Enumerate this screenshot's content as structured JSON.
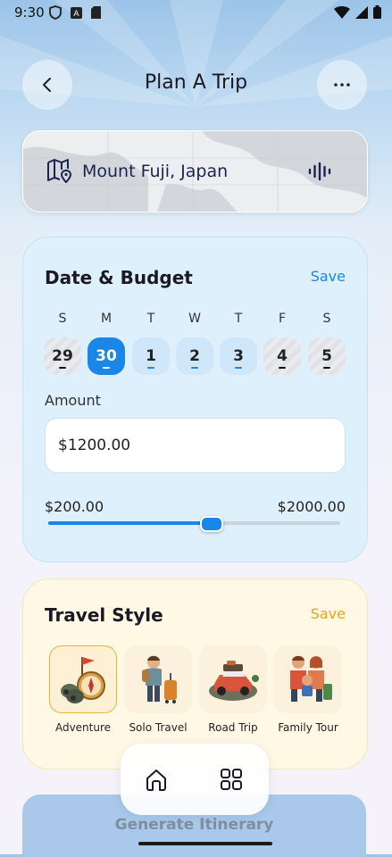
{
  "status_bar": {
    "time": "9:30"
  },
  "header": {
    "title": "Plan A Trip"
  },
  "destination": {
    "location": "Mount Fuji, Japan"
  },
  "date_budget": {
    "title": "Date & Budget",
    "save_label": "Save",
    "days": [
      {
        "letter": "S",
        "date": "29"
      },
      {
        "letter": "M",
        "date": "30"
      },
      {
        "letter": "T",
        "date": "1"
      },
      {
        "letter": "W",
        "date": "2"
      },
      {
        "letter": "T",
        "date": "3"
      },
      {
        "letter": "F",
        "date": "4"
      },
      {
        "letter": "S",
        "date": "5"
      }
    ],
    "amount_label": "Amount",
    "amount_value": "$1200.00",
    "range_min": "$200.00",
    "range_max": "$2000.00",
    "slider_fraction": 0.56
  },
  "travel_style": {
    "title": "Travel Style",
    "save_label": "Save",
    "options": [
      {
        "label": "Adventure"
      },
      {
        "label": "Solo Travel"
      },
      {
        "label": "Road Trip"
      },
      {
        "label": "Family Tour"
      }
    ]
  },
  "bottom_nav": {
    "items": [
      "home-icon",
      "grid-icon"
    ]
  },
  "cta": {
    "label": "Generate Itinerary"
  },
  "colors": {
    "accent": "#1a86e8",
    "save_gold": "#e6a417",
    "selected_day": "#1a86e8"
  }
}
